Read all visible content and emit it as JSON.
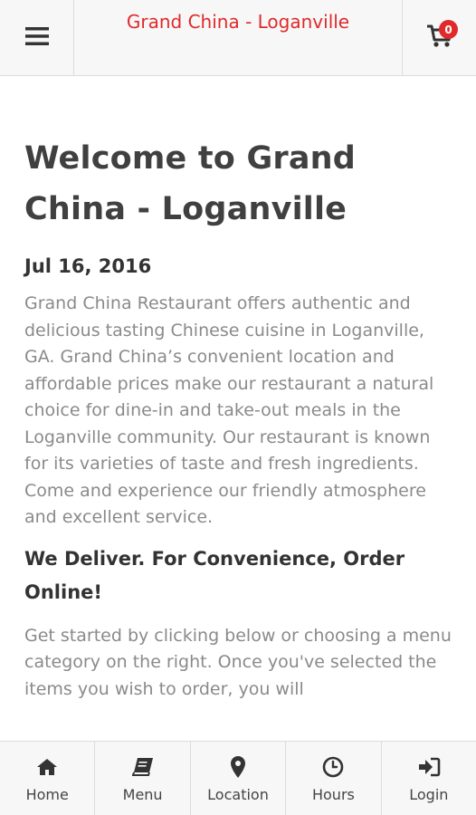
{
  "header": {
    "title": "Grand China - Loganville",
    "menu_icon": "hamburger-icon",
    "cart_icon": "shopping-cart-icon",
    "cart_count": "0"
  },
  "main": {
    "title": "Welcome to Grand China - Loganville",
    "date": "Jul 16, 2016",
    "intro": "Grand China Restaurant offers authentic and delicious tasting Chinese cuisine in Loganville, GA. Grand China’s convenient location and affordable prices make our restaurant a natural choice for dine-in and take-out meals in the Loganville community. Our restaurant is known for its varieties of taste and fresh ingredients. Come and experience our friendly atmosphere and excellent service.",
    "subheading": "We Deliver. For Convenience, Order Online!",
    "cta": "Get started by clicking below or choosing a menu category on the right. Once you've selected the items you wish to order, you will"
  },
  "bottom_nav": {
    "items": [
      {
        "label": "Home",
        "icon": "home-icon"
      },
      {
        "label": "Menu",
        "icon": "book-icon"
      },
      {
        "label": "Location",
        "icon": "map-marker-icon"
      },
      {
        "label": "Hours",
        "icon": "clock-icon"
      },
      {
        "label": "Login",
        "icon": "sign-in-icon"
      }
    ]
  },
  "colors": {
    "brand_red": "#e0292b",
    "bar_bg": "#f7f7f7",
    "body_text": "#8a8a8a",
    "heading_text": "#404040"
  }
}
